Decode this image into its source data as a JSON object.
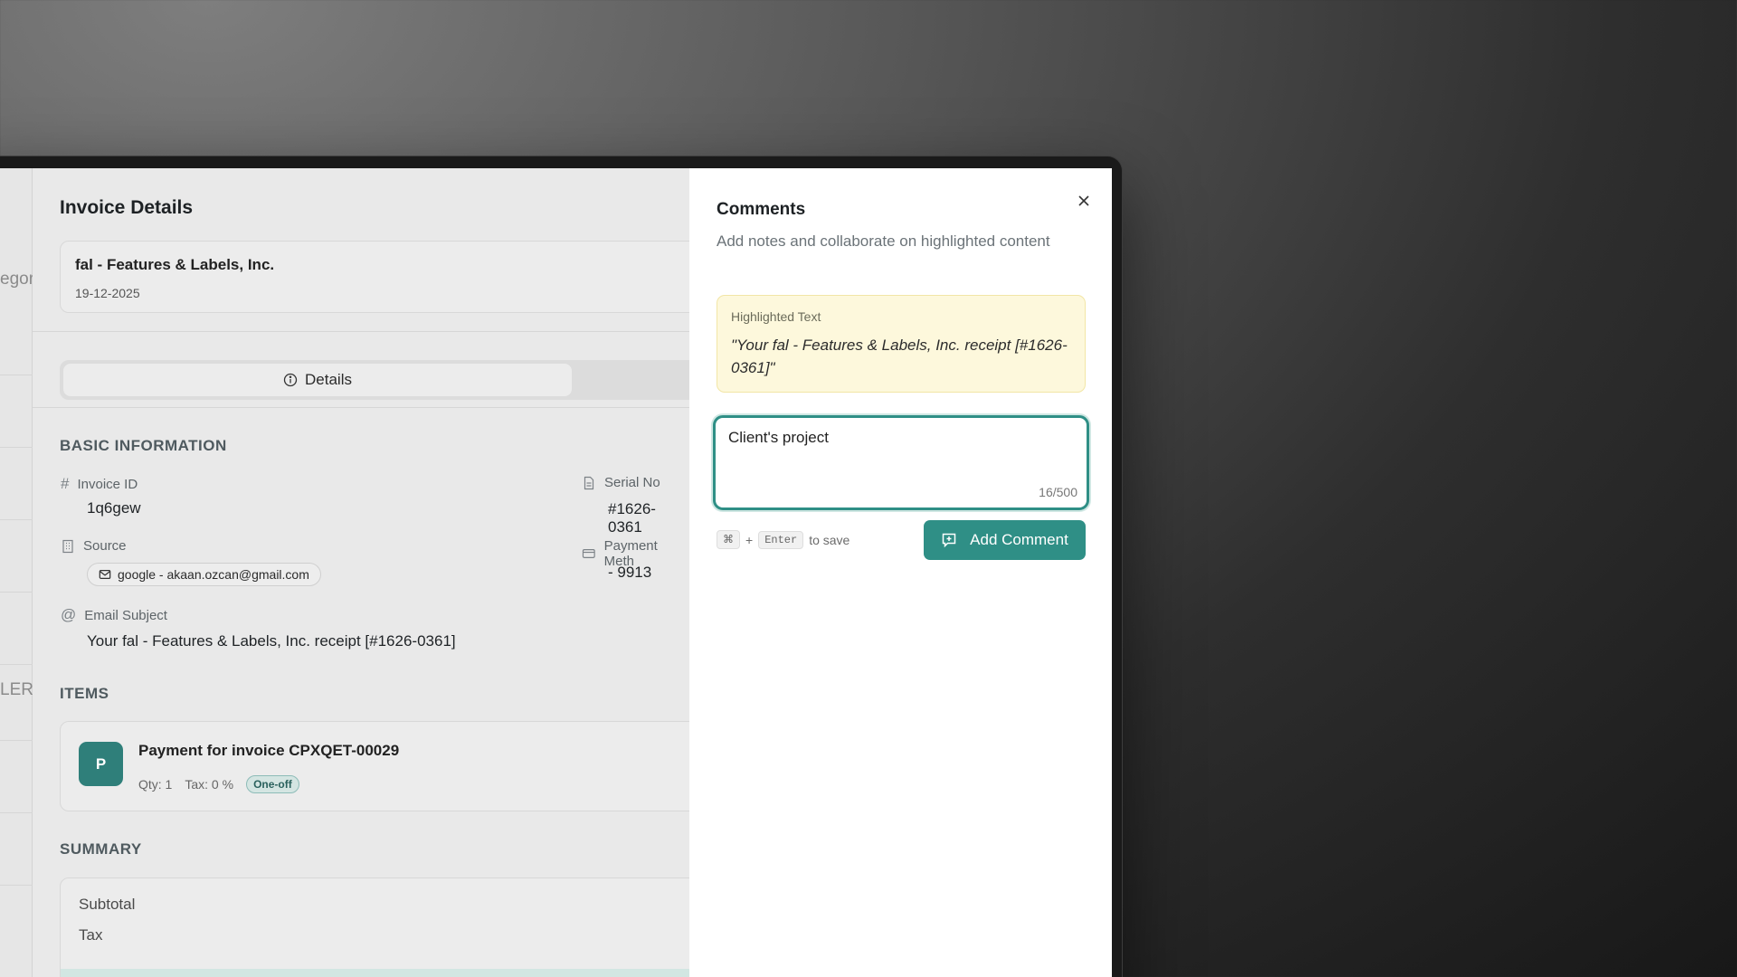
{
  "background_app": {
    "fragments": [
      "egory",
      "LERİ"
    ]
  },
  "invoice": {
    "title": "Invoice Details",
    "vendor_name": "fal - Features & Labels, Inc.",
    "date": "19-12-2025",
    "tab_details_label": "Details",
    "basic_info_heading": "BASIC INFORMATION",
    "invoice_id_label": "Invoice ID",
    "invoice_id_value": "1q6gew",
    "serial_no_label": "Serial No",
    "serial_no_value": "#1626-0361",
    "source_label": "Source",
    "source_value": "google - akaan.ozcan@gmail.com",
    "payment_method_label": "Payment Meth",
    "payment_method_value": "- 9913",
    "email_subject_label": "Email Subject",
    "email_subject_value": "Your fal - Features & Labels, Inc. receipt [#1626-0361]",
    "items_heading": "ITEMS",
    "item": {
      "avatar_letter": "P",
      "title": "Payment for invoice CPXQET-00029",
      "qty": "Qty: 1",
      "tax": "Tax: 0 %",
      "badge": "One-off"
    },
    "summary_heading": "SUMMARY",
    "subtotal_label": "Subtotal",
    "tax_label": "Tax"
  },
  "comments": {
    "title": "Comments",
    "subtitle": "Add notes and collaborate on highlighted content",
    "highlight_label": "Highlighted Text",
    "highlight_text": "\"Your fal - Features & Labels, Inc. receipt [#1626-0361]\"",
    "input_value": "Client's project",
    "counter": "16/500",
    "hint_key1": "⌘",
    "hint_plus": "+",
    "hint_key2": "Enter",
    "hint_suffix": "to save",
    "add_button_label": "Add Comment"
  },
  "colors": {
    "accent": "#2f8f86",
    "highlight_bg": "#fdf8dc"
  }
}
